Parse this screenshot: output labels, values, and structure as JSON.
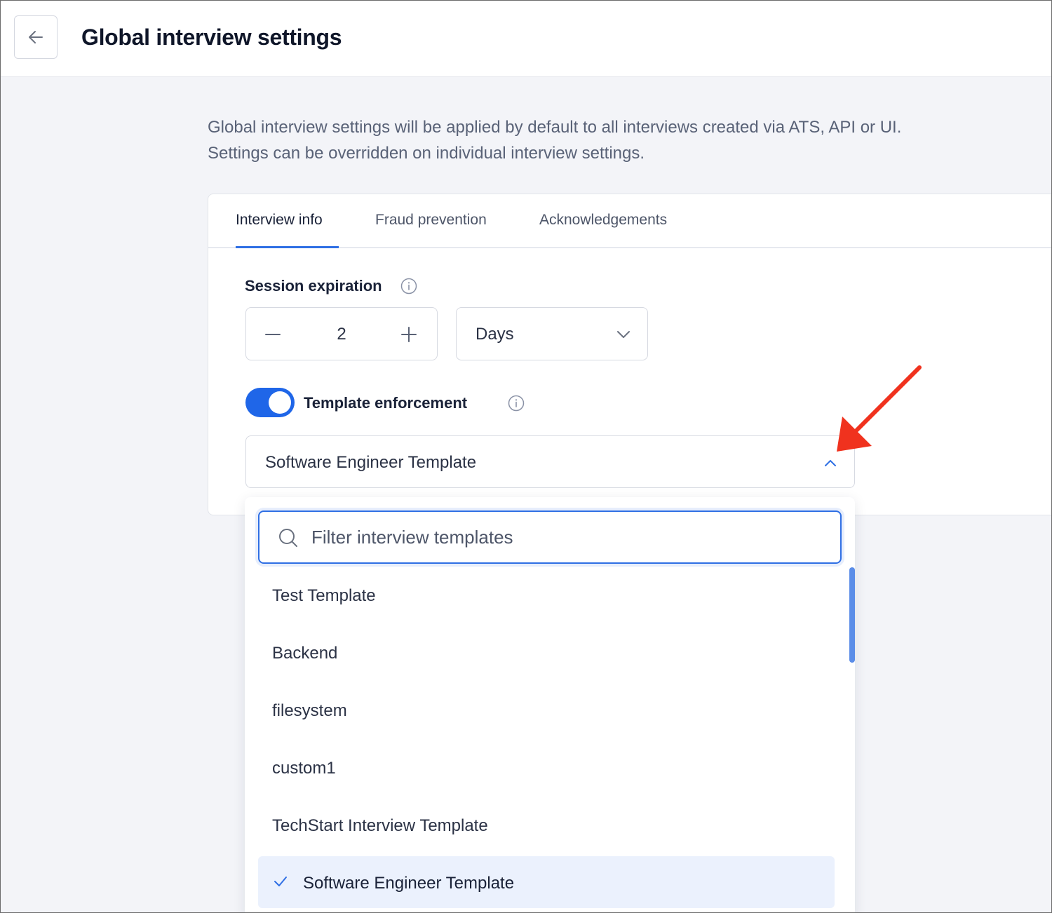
{
  "header": {
    "title": "Global interview settings",
    "back_icon": "arrow-left-icon"
  },
  "intro": {
    "line1": "Global interview settings will be applied by default to all interviews created via ATS, API or UI.",
    "line2": "Settings can be overridden on individual interview settings."
  },
  "tabs": [
    {
      "label": "Interview info",
      "active": true
    },
    {
      "label": "Fraud prevention",
      "active": false
    },
    {
      "label": "Acknowledgements",
      "active": false
    }
  ],
  "session_expiration": {
    "label": "Session expiration",
    "value": "2",
    "unit": "Days"
  },
  "template_enforcement": {
    "label": "Template enforcement",
    "enabled": true,
    "selected": "Software Engineer Template"
  },
  "dropdown": {
    "search_placeholder": "Filter interview templates",
    "options": [
      {
        "label": "Test Template",
        "selected": false
      },
      {
        "label": "Backend",
        "selected": false
      },
      {
        "label": "filesystem",
        "selected": false
      },
      {
        "label": "custom1",
        "selected": false
      },
      {
        "label": "TechStart Interview Template",
        "selected": false
      },
      {
        "label": "Software Engineer Template",
        "selected": true
      }
    ]
  },
  "colors": {
    "accent": "#1f66e8",
    "annotation_arrow": "#f0321e",
    "background": "#f3f4f8",
    "selected_option_bg": "#ebf1fd"
  }
}
